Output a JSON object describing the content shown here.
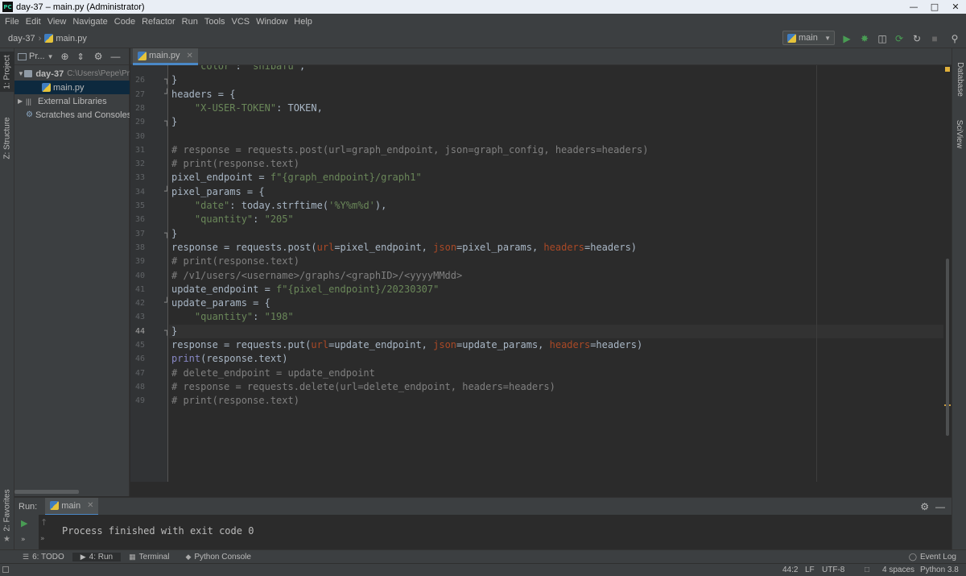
{
  "window": {
    "title": "day-37 – main.py (Administrator)",
    "logo_text": "PC"
  },
  "menu": [
    "File",
    "Edit",
    "View",
    "Navigate",
    "Code",
    "Refactor",
    "Run",
    "Tools",
    "VCS",
    "Window",
    "Help"
  ],
  "navbar": {
    "project": "day-37",
    "file": "main.py",
    "run_config": "main"
  },
  "left_stripe": {
    "project_tab": "1: Project",
    "structure_tab": "Z: Structure",
    "favorites_tab": "2: Favorites"
  },
  "right_stripe": {
    "database_tab": "Database",
    "sciview_tab": "SciView"
  },
  "project_panel": {
    "header": "Pr...",
    "tree": {
      "root": "day-37",
      "root_path": "C:\\Users\\Pepe\\Pr",
      "file": "main.py",
      "external": "External Libraries",
      "scratches": "Scratches and Consoles"
    }
  },
  "editor": {
    "tab": "main.py",
    "cursor_line": 44,
    "lines": [
      {
        "n": "",
        "text": "    \"color\": \"shibafu\","
      },
      {
        "n": "26",
        "text": "}"
      },
      {
        "n": "27",
        "text": "headers = {"
      },
      {
        "n": "28",
        "text": "    \"X-USER-TOKEN\": TOKEN,"
      },
      {
        "n": "29",
        "text": "}"
      },
      {
        "n": "30",
        "text": ""
      },
      {
        "n": "31",
        "text": "# response = requests.post(url=graph_endpoint, json=graph_config, headers=headers)"
      },
      {
        "n": "32",
        "text": "# print(response.text)"
      },
      {
        "n": "33",
        "text": "pixel_endpoint = f\"{graph_endpoint}/graph1\""
      },
      {
        "n": "34",
        "text": "pixel_params = {"
      },
      {
        "n": "35",
        "text": "    \"date\": today.strftime('%Y%m%d'),"
      },
      {
        "n": "36",
        "text": "    \"quantity\": \"205\""
      },
      {
        "n": "37",
        "text": "}"
      },
      {
        "n": "38",
        "text": "response = requests.post(url=pixel_endpoint, json=pixel_params, headers=headers)"
      },
      {
        "n": "39",
        "text": "# print(response.text)"
      },
      {
        "n": "40",
        "text": "# /v1/users/<username>/graphs/<graphID>/<yyyyMMdd>"
      },
      {
        "n": "41",
        "text": "update_endpoint = f\"{pixel_endpoint}/20230307\""
      },
      {
        "n": "42",
        "text": "update_params = {"
      },
      {
        "n": "43",
        "text": "    \"quantity\": \"198\""
      },
      {
        "n": "44",
        "text": "}"
      },
      {
        "n": "45",
        "text": "response = requests.put(url=update_endpoint, json=update_params, headers=headers)"
      },
      {
        "n": "46",
        "text": "print(response.text)"
      },
      {
        "n": "47",
        "text": "# delete_endpoint = update_endpoint"
      },
      {
        "n": "48",
        "text": "# response = requests.delete(url=delete_endpoint, headers=headers)"
      },
      {
        "n": "49",
        "text": "# print(response.text)"
      }
    ]
  },
  "run_panel": {
    "label": "Run:",
    "config": "main",
    "output": "Process finished with exit code 0"
  },
  "bottom_tools": [
    {
      "label": "6: TODO",
      "icon": "list-icon"
    },
    {
      "label": "4: Run",
      "icon": "play-icon"
    },
    {
      "label": "Terminal",
      "icon": "terminal-icon"
    },
    {
      "label": "Python Console",
      "icon": "python-console-icon"
    }
  ],
  "event_log": "Event Log",
  "status": {
    "position": "44:2",
    "line_sep": "LF",
    "encoding": "UTF-8",
    "indent": "4 spaces",
    "interpreter": "Python 3.8"
  },
  "colors": {
    "accent": "#4a88c7",
    "run_green": "#499c54",
    "keyword": "#cc7832",
    "string": "#6a8759",
    "comment": "#808080"
  }
}
